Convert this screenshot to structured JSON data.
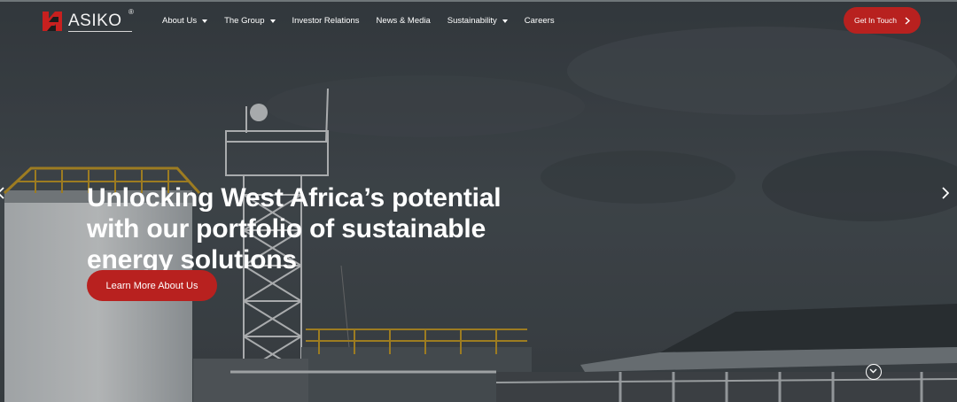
{
  "brand": {
    "name": "ASIKO",
    "registered_mark": "®",
    "colors": {
      "accent": "#b8211f",
      "text": "#ffffff"
    }
  },
  "nav": {
    "items": [
      {
        "label": "About Us",
        "has_dropdown": true
      },
      {
        "label": "The Group",
        "has_dropdown": true
      },
      {
        "label": "Investor Relations",
        "has_dropdown": false
      },
      {
        "label": "News & Media",
        "has_dropdown": false
      },
      {
        "label": "Sustainability",
        "has_dropdown": true
      },
      {
        "label": "Careers",
        "has_dropdown": false
      }
    ],
    "cta": {
      "label": "Get In Touch",
      "icon": "chevron-right-icon"
    }
  },
  "hero": {
    "headline_lines": [
      "Unlocking West Africa’s potential",
      "with our portfolio of sustainable",
      "energy solutions"
    ],
    "button_label": "Learn More About Us",
    "prev_icon": "chevron-left-icon",
    "next_icon": "chevron-right-icon",
    "scroll_icon": "chevron-down-circle-icon"
  }
}
